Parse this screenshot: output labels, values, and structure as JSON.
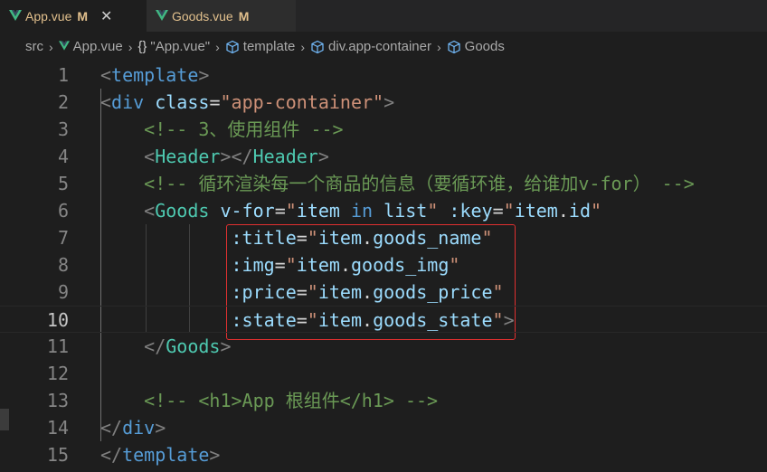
{
  "tabs": [
    {
      "name": "App.vue",
      "status": "M",
      "close": "✕",
      "icon": "vue-icon",
      "active": true
    },
    {
      "name": "Goods.vue",
      "status": "M",
      "icon": "vue-icon",
      "active": false
    }
  ],
  "breadcrumb": {
    "src": "src",
    "file": "App.vue",
    "braces": "{}",
    "module": "\"App.vue\"",
    "template": "template",
    "div": "div.app-container",
    "goods": "Goods"
  },
  "editor": {
    "active_line": 10,
    "lines": [
      {
        "n": "1",
        "tokens": [
          [
            "t-punc",
            "<"
          ],
          [
            "t-tag",
            "template"
          ],
          [
            "t-punc",
            ">"
          ]
        ]
      },
      {
        "n": "2",
        "tokens": [
          [
            "t-punc",
            "<"
          ],
          [
            "t-tag",
            "div"
          ],
          [
            "t-white",
            " "
          ],
          [
            "t-attr",
            "class"
          ],
          [
            "t-eq",
            "="
          ],
          [
            "t-str",
            "\"app-container\""
          ],
          [
            "t-punc",
            ">"
          ]
        ]
      },
      {
        "n": "3",
        "tokens": [
          [
            "t-white",
            "    "
          ],
          [
            "t-com",
            "<!-- 3、使用组件 -->"
          ]
        ]
      },
      {
        "n": "4",
        "tokens": [
          [
            "t-white",
            "    "
          ],
          [
            "t-punc",
            "<"
          ],
          [
            "t-comp",
            "Header"
          ],
          [
            "t-punc",
            "></"
          ],
          [
            "t-comp",
            "Header"
          ],
          [
            "t-punc",
            ">"
          ]
        ]
      },
      {
        "n": "5",
        "tokens": [
          [
            "t-white",
            "    "
          ],
          [
            "t-com",
            "<!-- 循环渲染每一个商品的信息（要循环谁，给谁加v-for） -->"
          ]
        ]
      },
      {
        "n": "6",
        "tokens": [
          [
            "t-white",
            "    "
          ],
          [
            "t-punc",
            "<"
          ],
          [
            "t-comp",
            "Goods"
          ],
          [
            "t-white",
            " "
          ],
          [
            "t-attr",
            "v-for"
          ],
          [
            "t-eq",
            "="
          ],
          [
            "t-str",
            "\""
          ],
          [
            "t-attr",
            "item"
          ],
          [
            "t-white",
            " "
          ],
          [
            "t-tag",
            "in"
          ],
          [
            "t-white",
            " "
          ],
          [
            "t-attr",
            "list"
          ],
          [
            "t-str",
            "\""
          ],
          [
            "t-white",
            " "
          ],
          [
            "t-attr",
            ":key"
          ],
          [
            "t-eq",
            "="
          ],
          [
            "t-str",
            "\""
          ],
          [
            "t-attr",
            "item"
          ],
          [
            "t-white",
            "."
          ],
          [
            "t-attr",
            "id"
          ],
          [
            "t-str",
            "\""
          ]
        ]
      },
      {
        "n": "7",
        "tokens": [
          [
            "t-white",
            "            "
          ],
          [
            "t-attr",
            ":title"
          ],
          [
            "t-eq",
            "="
          ],
          [
            "t-str",
            "\""
          ],
          [
            "t-attr",
            "item"
          ],
          [
            "t-white",
            "."
          ],
          [
            "t-attr",
            "goods_name"
          ],
          [
            "t-str",
            "\""
          ]
        ]
      },
      {
        "n": "8",
        "tokens": [
          [
            "t-white",
            "            "
          ],
          [
            "t-attr",
            ":img"
          ],
          [
            "t-eq",
            "="
          ],
          [
            "t-str",
            "\""
          ],
          [
            "t-attr",
            "item"
          ],
          [
            "t-white",
            "."
          ],
          [
            "t-attr",
            "goods_img"
          ],
          [
            "t-str",
            "\""
          ]
        ]
      },
      {
        "n": "9",
        "tokens": [
          [
            "t-white",
            "            "
          ],
          [
            "t-attr",
            ":price"
          ],
          [
            "t-eq",
            "="
          ],
          [
            "t-str",
            "\""
          ],
          [
            "t-attr",
            "item"
          ],
          [
            "t-white",
            "."
          ],
          [
            "t-attr",
            "goods_price"
          ],
          [
            "t-str",
            "\""
          ]
        ]
      },
      {
        "n": "10",
        "tokens": [
          [
            "t-white",
            "            "
          ],
          [
            "t-attr",
            ":state"
          ],
          [
            "t-eq",
            "="
          ],
          [
            "t-str",
            "\""
          ],
          [
            "t-attr",
            "item"
          ],
          [
            "t-white",
            "."
          ],
          [
            "t-attr",
            "goods_state"
          ],
          [
            "t-str",
            "\""
          ],
          [
            "t-punc",
            ">"
          ]
        ]
      },
      {
        "n": "11",
        "tokens": [
          [
            "t-white",
            "    "
          ],
          [
            "t-punc",
            "</"
          ],
          [
            "t-comp",
            "Goods"
          ],
          [
            "t-punc",
            ">"
          ]
        ]
      },
      {
        "n": "12",
        "tokens": []
      },
      {
        "n": "13",
        "tokens": [
          [
            "t-white",
            "    "
          ],
          [
            "t-com",
            "<!-- <h1>App 根组件</h1> -->"
          ]
        ]
      },
      {
        "n": "14",
        "tokens": [
          [
            "t-punc",
            "</"
          ],
          [
            "t-tag",
            "div"
          ],
          [
            "t-punc",
            ">"
          ]
        ]
      },
      {
        "n": "15",
        "tokens": [
          [
            "t-punc",
            "</"
          ],
          [
            "t-tag",
            "template"
          ],
          [
            "t-punc",
            ">"
          ]
        ]
      }
    ]
  },
  "colors": {
    "background": "#1e1e1e",
    "tab_modified": "#e2c08d",
    "highlight_box": "#e03030"
  }
}
